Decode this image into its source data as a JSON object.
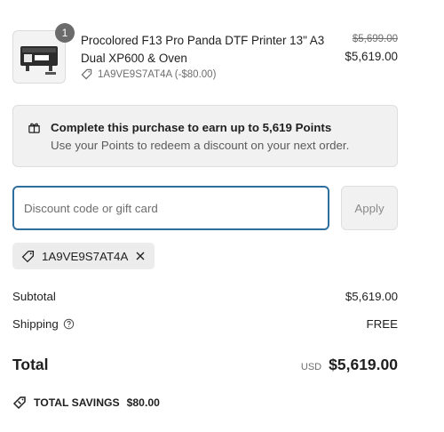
{
  "product": {
    "quantity": "1",
    "title": "Procolored F13 Pro Panda DTF Printer 13\" A3 Dual XP600 & Oven",
    "discount_line": "1A9VE9S7AT4A (-$80.00)",
    "original_price": "$5,699.00",
    "price": "$5,619.00"
  },
  "points": {
    "headline": "Complete this purchase to earn up to 5,619 Points",
    "subtext": "Use your Points to redeem a discount on your next order."
  },
  "discount": {
    "placeholder": "Discount code or gift card",
    "apply_label": "Apply",
    "applied_code": "1A9VE9S7AT4A"
  },
  "summary": {
    "subtotal_label": "Subtotal",
    "subtotal_value": "$5,619.00",
    "shipping_label": "Shipping",
    "shipping_value": "FREE",
    "total_label": "Total",
    "currency": "USD",
    "total_value": "$5,619.00",
    "savings_label": "TOTAL SAVINGS",
    "savings_value": "$80.00"
  },
  "colors": {
    "focus_border": "#2e6f9e",
    "panel_bg": "#f1f1f1",
    "muted_text": "#6e6e6e"
  }
}
